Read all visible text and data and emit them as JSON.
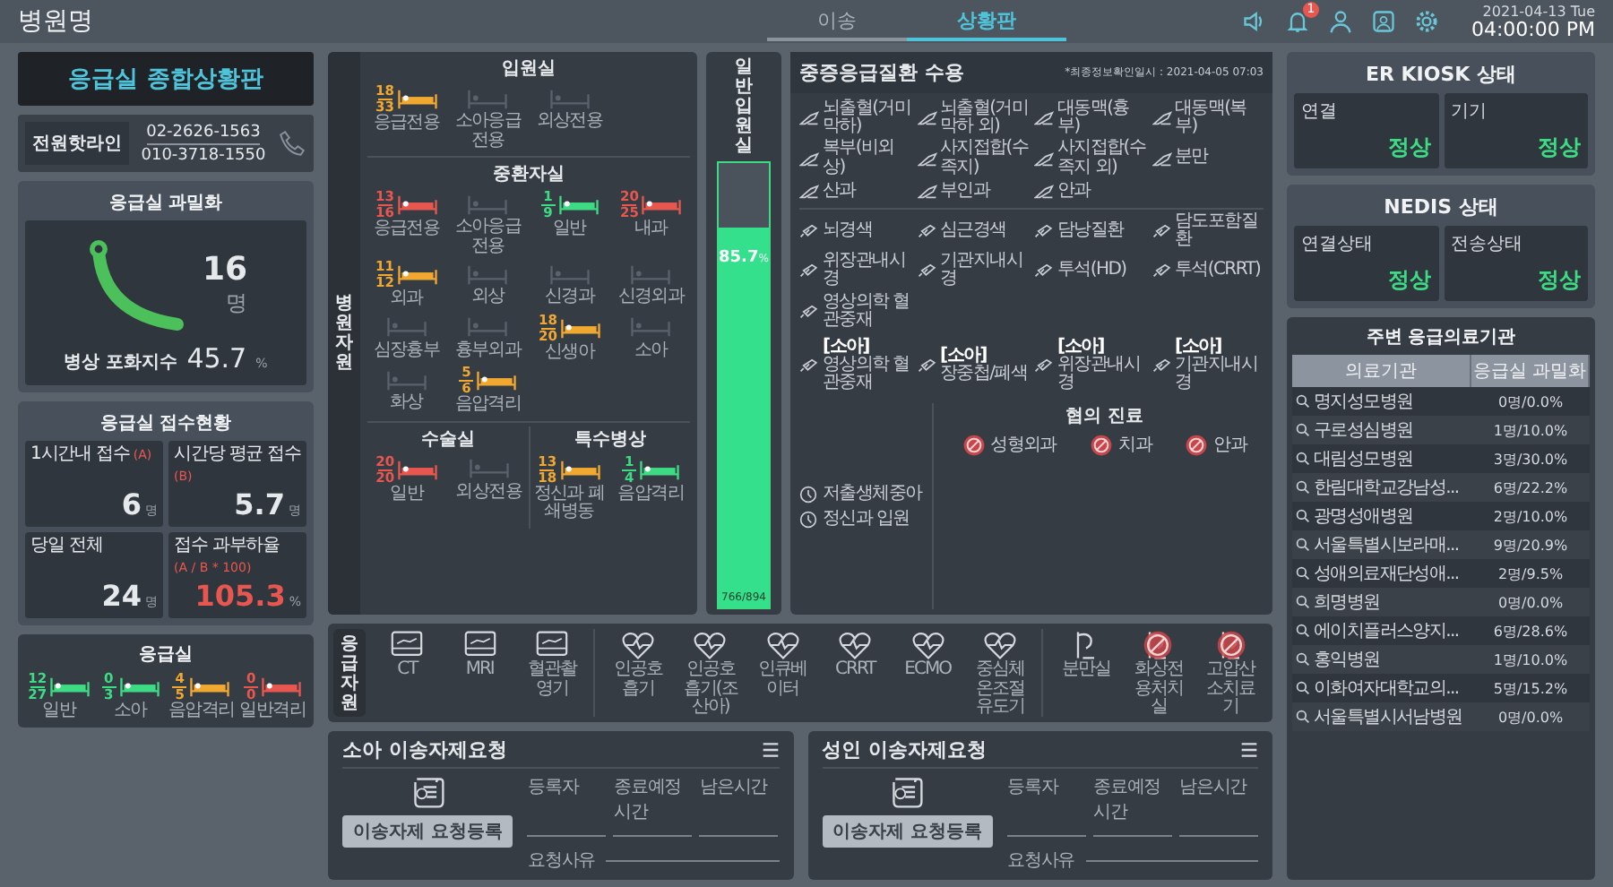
{
  "header": {
    "hospital_name": "병원명",
    "tabs": [
      {
        "label": "이송",
        "selected": false
      },
      {
        "label": "상황판",
        "selected": true
      }
    ],
    "notification_count": "1",
    "date": "2021-04-13 Tue",
    "time": "04:00:00 PM"
  },
  "board_title": "응급실 종합상황판",
  "hotline": {
    "label": "전원핫라인",
    "numbers": [
      "02-2626-1563",
      "010-3718-1550"
    ]
  },
  "overcrowding": {
    "title": "응급실 과밀화",
    "count": "16",
    "unit": "명",
    "index_label": "병상 포화지수",
    "index_value": "45.7",
    "index_unit": "%"
  },
  "reception": {
    "title": "응급실 접수현황",
    "cards": [
      {
        "label": "1시간내 접수",
        "note": "(A)",
        "value": "6",
        "unit": "명",
        "alert": false
      },
      {
        "label": "시간당 평균 접수",
        "note": "(B)",
        "value": "5.7",
        "unit": "명",
        "alert": false
      },
      {
        "label": "당일 전체",
        "value": "24",
        "unit": "명",
        "alert": false
      },
      {
        "label": "접수 과부하율",
        "note": "(A / B * 100)",
        "value": "105.3",
        "unit": "%",
        "alert": true
      }
    ]
  },
  "er_beds": {
    "title": "응급실",
    "beds": [
      {
        "label": "일반",
        "color": "#3ddc84",
        "occupied": "12",
        "total": "27"
      },
      {
        "label": "소아",
        "color": "#3ddc84",
        "occupied": "0",
        "total": "3"
      },
      {
        "label": "음압격리",
        "color": "#f0a830",
        "occupied": "4",
        "total": "5"
      },
      {
        "label": "일반격리",
        "color": "#e8574f",
        "occupied": "0",
        "total": "0"
      }
    ]
  },
  "hospital_resources": {
    "label": "병원자원",
    "sections": [
      {
        "title": "입원실",
        "beds": [
          {
            "label": "응급전용",
            "color": "#f0a830",
            "occupied": "18",
            "total": "33"
          },
          {
            "label": "소아응급전용"
          },
          {
            "label": "외상전용"
          }
        ]
      },
      {
        "title": "중환자실",
        "beds": [
          {
            "label": "응급전용",
            "color": "#e8574f",
            "occupied": "13",
            "total": "16"
          },
          {
            "label": "소아응급전용"
          },
          {
            "label": "일반",
            "color": "#3ddc84",
            "occupied": "1",
            "total": "9"
          },
          {
            "label": "내과",
            "color": "#e8574f",
            "occupied": "20",
            "total": "25"
          },
          {
            "label": "외과",
            "color": "#f0a830",
            "occupied": "11",
            "total": "12"
          },
          {
            "label": "외상"
          },
          {
            "label": "신경과"
          },
          {
            "label": "신경외과"
          },
          {
            "label": "심장흉부"
          },
          {
            "label": "흉부외과"
          },
          {
            "label": "신생아",
            "color": "#f0a830",
            "occupied": "18",
            "total": "20"
          },
          {
            "label": "소아"
          },
          {
            "label": "화상"
          },
          {
            "label": "음압격리",
            "color": "#f0a830",
            "occupied": "5",
            "total": "6"
          }
        ]
      },
      {
        "title": "수술실",
        "beds": [
          {
            "label": "일반",
            "color": "#e8574f",
            "occupied": "20",
            "total": "20"
          },
          {
            "label": "외상전용"
          }
        ]
      },
      {
        "title": "특수병상",
        "beds": [
          {
            "label": "정신과 폐쇄병동",
            "color": "#f0a830",
            "occupied": "13",
            "total": "18"
          },
          {
            "label": "음압격리",
            "color": "#3ddc84",
            "occupied": "1",
            "total": "4"
          }
        ]
      }
    ]
  },
  "general_ward": {
    "title": "일반입원실",
    "level": 0.857,
    "percent": "85.7",
    "unit": "%",
    "count": "766/894"
  },
  "severe_disease": {
    "title": "중증응급질환 수용",
    "updated": "*최종정보확인일시 : 2021-04-05 07:03",
    "groups": [
      {
        "kind": "surgery",
        "items": [
          {
            "label": "뇌출혈(거미막하)"
          },
          {
            "label": "뇌출혈(거미막하 외)"
          },
          {
            "label": "대동맥(흉부)"
          },
          {
            "label": "대동맥(복부)"
          },
          {
            "label": "복부(비외상)"
          },
          {
            "label": "사지접합(수족지)"
          },
          {
            "label": "사지접합(수족지 외)"
          },
          {
            "label": "분만"
          },
          {
            "label": "산과"
          },
          {
            "label": "부인과"
          },
          {
            "label": "안과"
          }
        ]
      },
      {
        "kind": "procedure",
        "items": [
          {
            "label": "뇌경색"
          },
          {
            "label": "심근경색"
          },
          {
            "label": "담낭질환"
          },
          {
            "label": "담도포함질환"
          },
          {
            "label": "위장관내시경"
          },
          {
            "label": "기관지내시경"
          },
          {
            "label": "투석(HD)"
          },
          {
            "label": "투석(CRRT)"
          },
          {
            "label": "영상의학 혈관중재"
          }
        ]
      },
      {
        "kind": "procedure",
        "items": [
          {
            "label": "**[소아]** 영상의학 혈관중재"
          },
          {
            "label": "**[소아]** 장중첩/폐색"
          },
          {
            "label": "**[소아]** 위장관내시경"
          },
          {
            "label": "**[소아]** 기관지내시경"
          }
        ]
      }
    ],
    "special": [
      {
        "label": "저출생체중아"
      },
      {
        "label": "정신과 입원"
      }
    ],
    "consult": {
      "title": "협의 진료",
      "items": [
        {
          "label": "성형외과"
        },
        {
          "label": "치과"
        },
        {
          "label": "안과"
        }
      ]
    }
  },
  "emergency_resources": {
    "label": "응급자원",
    "items": [
      {
        "kind": "scanner",
        "label": "CT",
        "available": true
      },
      {
        "kind": "scanner",
        "label": "MRI",
        "available": true
      },
      {
        "kind": "scanner",
        "label": "혈관촬영기",
        "available": true
      },
      {
        "kind": "heart",
        "label": "인공호흡기",
        "available": true
      },
      {
        "kind": "heart",
        "label": "인공호흡기(조산아)",
        "available": true
      },
      {
        "kind": "heart",
        "label": "인큐베이터",
        "available": true
      },
      {
        "kind": "heart",
        "label": "CRRT",
        "available": true
      },
      {
        "kind": "heart",
        "label": "ECMO",
        "available": true
      },
      {
        "kind": "heart",
        "label": "중심체온조절유도기",
        "available": true
      },
      {
        "kind": "room",
        "label": "분만실",
        "available": true
      },
      {
        "kind": "room",
        "label": "화상전용처치실",
        "available": false
      },
      {
        "kind": "room",
        "label": "고압산소치료기",
        "available": false
      }
    ]
  },
  "transfer_requests": [
    {
      "title": "소아 이송자제요청",
      "columns": [
        "등록자",
        "종료예정시간",
        "남은시간"
      ],
      "reason_label": "요청사유",
      "button": "이송자제 요청등록"
    },
    {
      "title": "성인 이송자제요청",
      "columns": [
        "등록자",
        "종료예정시간",
        "남은시간"
      ],
      "reason_label": "요청사유",
      "button": "이송자제 요청등록"
    }
  ],
  "er_kiosk": {
    "title": "ER KIOSK 상태",
    "items": [
      {
        "label": "연결",
        "value": "정상"
      },
      {
        "label": "기기",
        "value": "정상"
      }
    ]
  },
  "nedis": {
    "title": "NEDIS 상태",
    "items": [
      {
        "label": "연결상태",
        "value": "정상"
      },
      {
        "label": "전송상태",
        "value": "정상"
      }
    ]
  },
  "nearby": {
    "title": "주변 응급의료기관",
    "columns": [
      "의료기관",
      "응급실 과밀화"
    ],
    "rows": [
      {
        "name": "명지성모병원",
        "value": "0명/0.0%"
      },
      {
        "name": "구로성심병원",
        "value": "1명/10.0%"
      },
      {
        "name": "대림성모병원",
        "value": "3명/30.0%"
      },
      {
        "name": "한림대학교강남성...",
        "value": "6명/22.2%"
      },
      {
        "name": "광명성애병원",
        "value": "2명/10.0%"
      },
      {
        "name": "서울특별시보라매...",
        "value": "9명/20.9%"
      },
      {
        "name": "성애의료재단성애...",
        "value": "2명/9.5%"
      },
      {
        "name": "희명병원",
        "value": "0명/0.0%"
      },
      {
        "name": "에이치플러스양지...",
        "value": "6명/28.6%"
      },
      {
        "name": "홍익병원",
        "value": "1명/10.0%"
      },
      {
        "name": "이화여자대학교의...",
        "value": "5명/15.2%"
      },
      {
        "name": "서울특별시서남병원",
        "value": "0명/0.0%"
      }
    ]
  }
}
